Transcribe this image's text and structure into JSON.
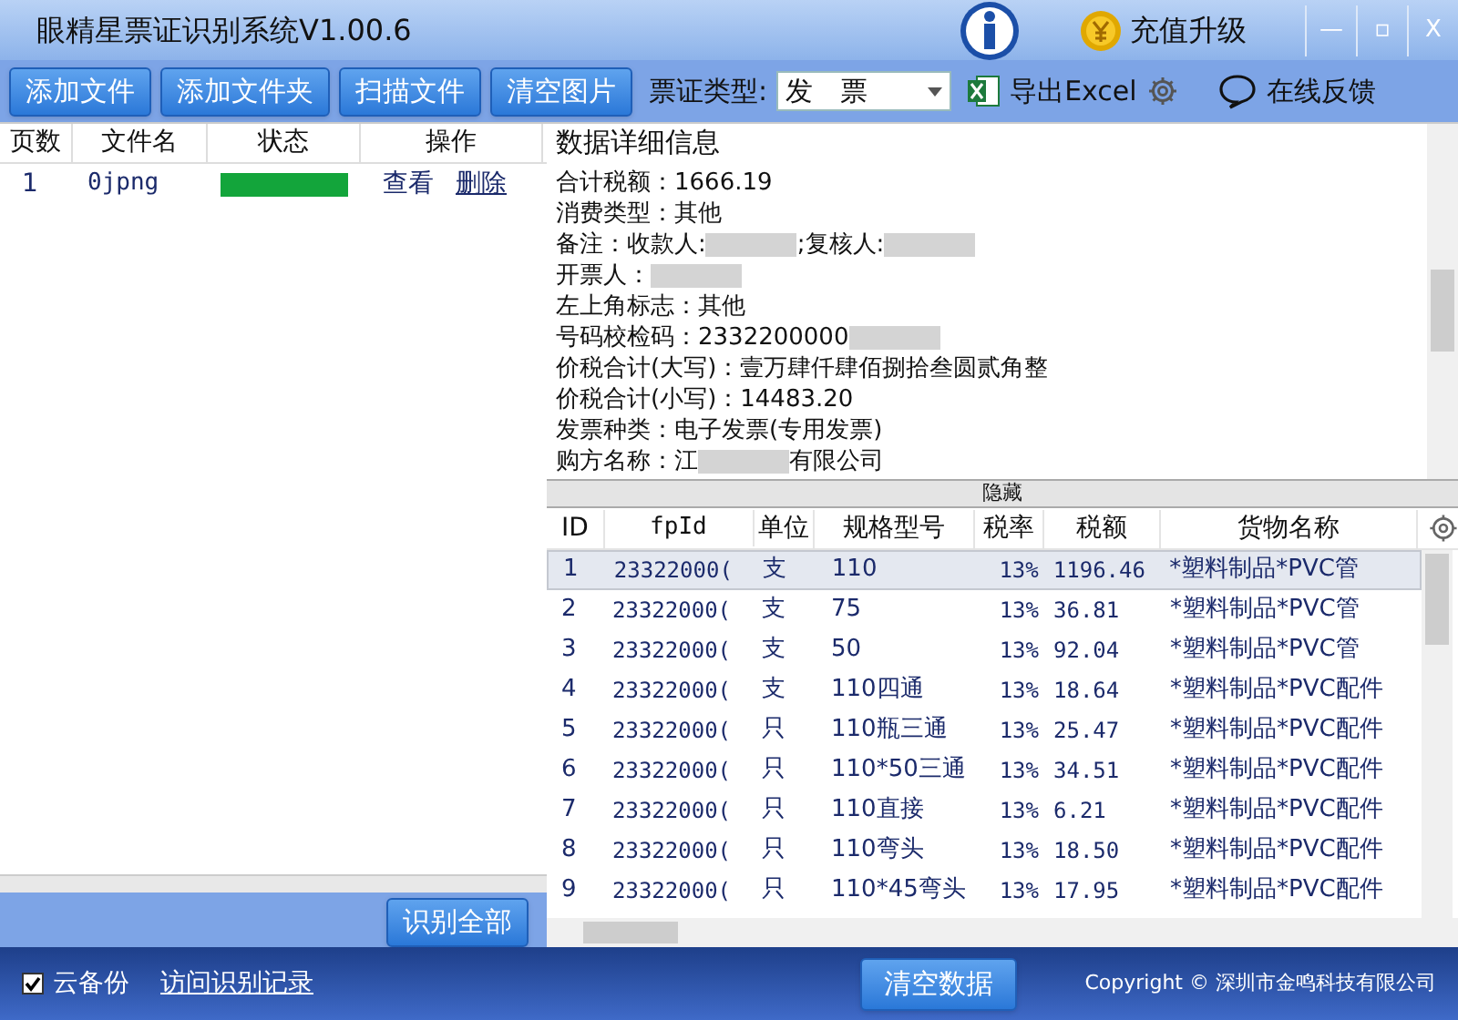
{
  "window": {
    "title": "眼精星票证识别系统V1.00.6",
    "upgrade": "充值升级",
    "controls": [
      "—",
      "▫",
      "X"
    ]
  },
  "toolbar": {
    "buttons": [
      "添加文件",
      "添加文件夹",
      "扫描文件",
      "清空图片"
    ],
    "type_label": "票证类型:",
    "type_value": "发　票",
    "export": "导出Excel",
    "feedback": "在线反馈"
  },
  "files": {
    "columns": [
      "页数",
      "文件名",
      "状态",
      "操作"
    ],
    "rows": [
      {
        "page": "1",
        "name": "0jpng",
        "level": 1,
        "view": "查看",
        "delete": "删除"
      }
    ],
    "recognize_all": "识别全部"
  },
  "details": {
    "title": "数据详细信息",
    "lines": [
      [
        {
          "kind": "text",
          "text": "合计税额：1666.19"
        }
      ],
      [
        {
          "kind": "text",
          "text": "消费类型：其他"
        }
      ],
      [
        {
          "kind": "text",
          "text": "备注：收款人:"
        },
        {
          "kind": "blur"
        },
        {
          "kind": "text",
          "text": ";复核人:"
        },
        {
          "kind": "blur"
        }
      ],
      [
        {
          "kind": "text",
          "text": "开票人："
        },
        {
          "kind": "blur"
        }
      ],
      [
        {
          "kind": "text",
          "text": "左上角标志：其他"
        }
      ],
      [
        {
          "kind": "text",
          "text": "号码校检码：2332200000"
        },
        {
          "kind": "blur"
        }
      ],
      [
        {
          "kind": "text",
          "text": "价税合计(大写)：壹万肆仟肆佰捌拾叁圆贰角整"
        }
      ],
      [
        {
          "kind": "text",
          "text": "价税合计(小写)：14483.20"
        }
      ],
      [
        {
          "kind": "text",
          "text": "发票种类：电子发票(专用发票)"
        }
      ],
      [
        {
          "kind": "text",
          "text": "购方名称：江"
        },
        {
          "kind": "blur"
        },
        {
          "kind": "text",
          "text": "有限公司"
        }
      ]
    ],
    "hide": "隐藏"
  },
  "items": {
    "columns": [
      "ID",
      "fpId",
      "单位",
      "规格型号",
      "税率",
      "税额",
      "货物名称"
    ],
    "rows": [
      {
        "selected": true,
        "cells": [
          "1",
          "23322000(",
          "支",
          "110",
          "13%",
          "1196.46",
          "*塑料制品*PVC管"
        ]
      },
      {
        "selected": false,
        "cells": [
          "2",
          "23322000(",
          "支",
          "75",
          "13%",
          "36.81",
          "*塑料制品*PVC管"
        ]
      },
      {
        "selected": false,
        "cells": [
          "3",
          "23322000(",
          "支",
          "50",
          "13%",
          "92.04",
          "*塑料制品*PVC管"
        ]
      },
      {
        "selected": false,
        "cells": [
          "4",
          "23322000(",
          "支",
          "110四通",
          "13%",
          "18.64",
          "*塑料制品*PVC配件"
        ]
      },
      {
        "selected": false,
        "cells": [
          "5",
          "23322000(",
          "只",
          "110瓶三通",
          "13%",
          "25.47",
          "*塑料制品*PVC配件"
        ]
      },
      {
        "selected": false,
        "cells": [
          "6",
          "23322000(",
          "只",
          "110*50三通",
          "13%",
          "34.51",
          "*塑料制品*PVC配件"
        ]
      },
      {
        "selected": false,
        "cells": [
          "7",
          "23322000(",
          "只",
          "110直接",
          "13%",
          "6.21",
          "*塑料制品*PVC配件"
        ]
      },
      {
        "selected": false,
        "cells": [
          "8",
          "23322000(",
          "只",
          "110弯头",
          "13%",
          "18.50",
          "*塑料制品*PVC配件"
        ]
      },
      {
        "selected": false,
        "cells": [
          "9",
          "23322000(",
          "只",
          "110*45弯头",
          "13%",
          "17.95",
          "*塑料制品*PVC配件"
        ]
      }
    ]
  },
  "footer": {
    "backup_label": "云备份",
    "backup_checked": true,
    "history": "访问识别记录",
    "clear": "清空数据",
    "copyright": "Copyright © 深圳市金鸣科技有限公司"
  }
}
